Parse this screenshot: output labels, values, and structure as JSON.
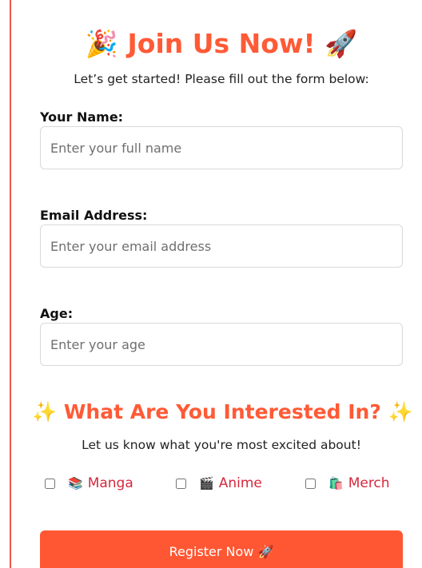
{
  "header": {
    "title": "🎉 Join Us Now! 🚀",
    "subtitle": "Let’s get started! Please fill out the form below:"
  },
  "form": {
    "name": {
      "label": "Your Name:",
      "placeholder": "Enter your full name",
      "value": ""
    },
    "email": {
      "label": "Email Address:",
      "placeholder": "Enter your email address",
      "value": ""
    },
    "age": {
      "label": "Age:",
      "placeholder": "Enter your age",
      "value": ""
    }
  },
  "interests": {
    "title": "✨ What Are You Interested In? ✨",
    "subtitle": "Let us know what you're most excited about!",
    "options": [
      {
        "emoji": "📚",
        "label": "Manga",
        "checked": false
      },
      {
        "emoji": "🎬",
        "label": "Anime",
        "checked": false
      },
      {
        "emoji": "🛍️",
        "label": "Merch",
        "checked": false
      }
    ]
  },
  "submit": {
    "label": "Register Now 🚀"
  },
  "colors": {
    "accent": "#ff5733",
    "heading": "#ff5a36",
    "interest_label": "#d6283d",
    "left_rule": "#e8574a"
  }
}
